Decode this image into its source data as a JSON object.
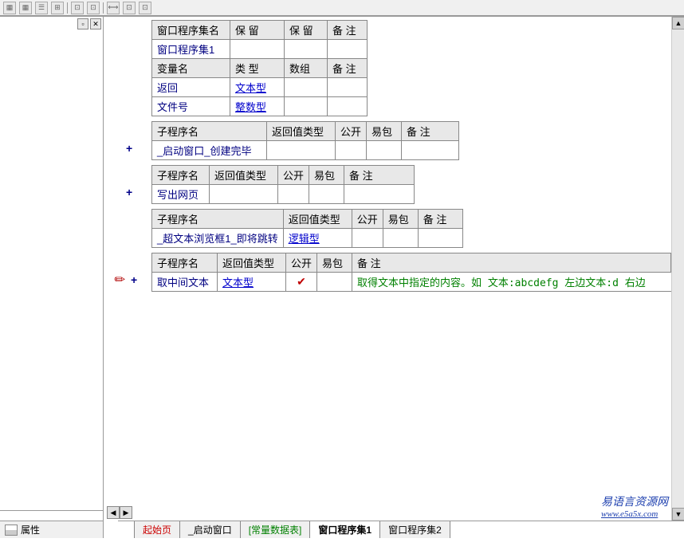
{
  "toolbar": {
    "icons": [
      "▦",
      "▦",
      "☰",
      "⊞",
      "|",
      "⊡",
      "⊡",
      "|",
      "⟷",
      "⊡",
      "⊡"
    ]
  },
  "leftPanel": {
    "propLabel": "属性"
  },
  "tables": {
    "programSet": {
      "headers": [
        "窗口程序集名",
        "保  留",
        "保  留",
        "备  注"
      ],
      "row1": [
        "窗口程序集1",
        "",
        "",
        ""
      ],
      "varHeaders": [
        "变量名",
        "类  型",
        "数组",
        "备  注"
      ],
      "var1": {
        "name": "返回",
        "type": "文本型"
      },
      "var2": {
        "name": "文件号",
        "type": "整数型"
      }
    },
    "sub1": {
      "headers": [
        "子程序名",
        "返回值类型",
        "公开",
        "易包",
        "备  注"
      ],
      "name": "_启动窗口_创建完毕"
    },
    "sub2": {
      "headers": [
        "子程序名",
        "返回值类型",
        "公开",
        "易包",
        "备  注"
      ],
      "name": "写出网页"
    },
    "sub3": {
      "headers": [
        "子程序名",
        "返回值类型",
        "公开",
        "易包",
        "备  注"
      ],
      "name": "_超文本浏览框1_即将跳转",
      "retType": "逻辑型"
    },
    "sub4": {
      "headers": [
        "子程序名",
        "返回值类型",
        "公开",
        "易包",
        "备  注"
      ],
      "name": "取中间文本",
      "retType": "文本型",
      "remark": "取得文本中指定的内容。如 文本:abcdefg 左边文本:d 右边"
    }
  },
  "tabs": {
    "t1": "起始页",
    "t2": "_启动窗口",
    "t3": "[常量数据表]",
    "t4": "窗口程序集1",
    "t5": "窗口程序集2"
  },
  "watermark": {
    "text": "易语言资源网",
    "url": "www.e5a5x.com"
  },
  "gutter": {
    "plus": "+"
  },
  "checkmark": "✔"
}
